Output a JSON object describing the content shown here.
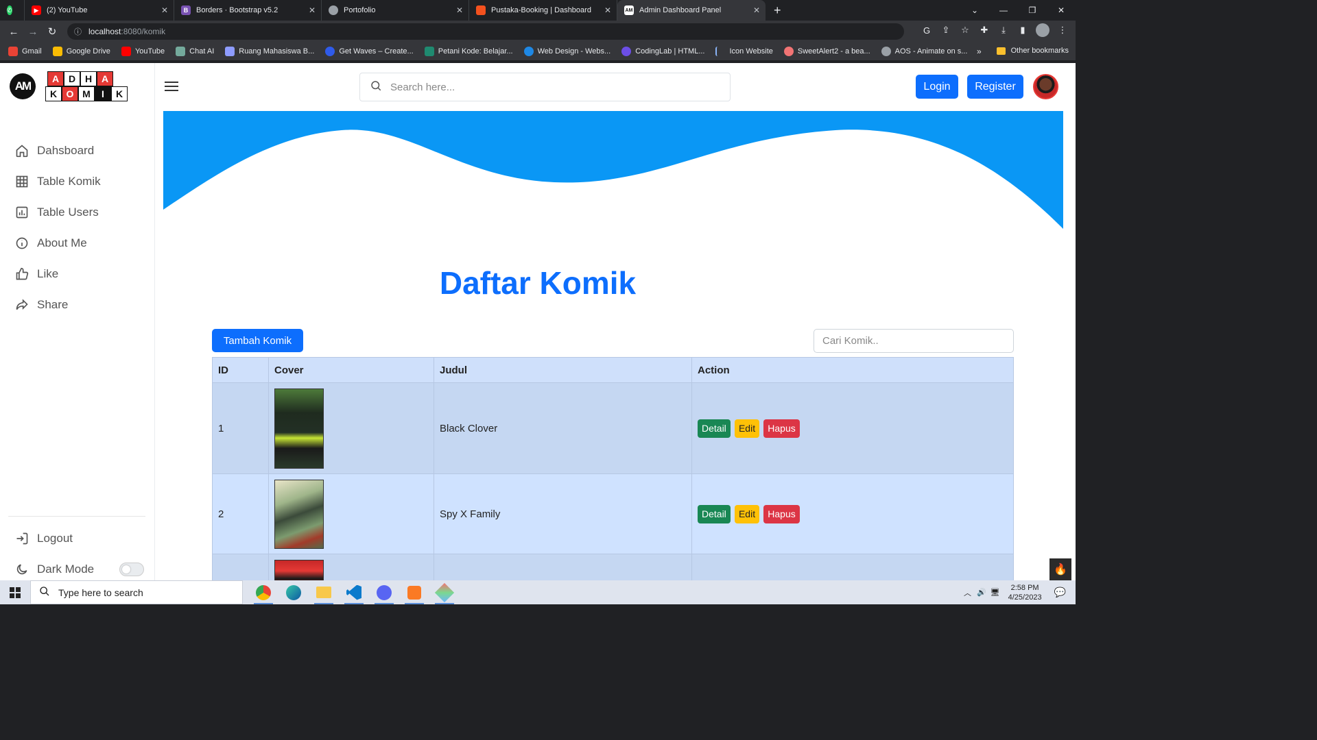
{
  "browser": {
    "tabs": [
      {
        "title": "(2) YouTube",
        "color": "#ff0000"
      },
      {
        "title": "Borders · Bootstrap v5.2",
        "color": "#7952b3",
        "glyph": "B"
      },
      {
        "title": "Portofolio",
        "color": "#9aa0a6"
      },
      {
        "title": "Pustaka-Booking | Dashboard",
        "color": "#f4511e"
      },
      {
        "title": "Admin Dashboard Panel",
        "color": "#ffffff",
        "glyph": "AM",
        "active": true
      }
    ],
    "url_host": "localhost",
    "url_path": ":8080/komik",
    "bookmarks": [
      "Gmail",
      "Google Drive",
      "YouTube",
      "Chat AI",
      "Ruang Mahasiswa B...",
      "Get Waves – Create...",
      "Petani Kode: Belajar...",
      "Web Design - Webs...",
      "CodingLab | HTML...",
      "Icon Website",
      "SweetAlert2 - a bea...",
      "AOS - Animate on s..."
    ],
    "bookmark_more": "»",
    "other_bookmarks": "Other bookmarks"
  },
  "sidebar": {
    "logo_mark": "AM",
    "logo_row1": [
      "A",
      "D",
      "H",
      "A"
    ],
    "logo_row2": [
      "K",
      "O",
      "M",
      "I",
      "K"
    ],
    "items": [
      {
        "label": "Dahsboard",
        "icon": "home-icon"
      },
      {
        "label": "Table Komik",
        "icon": "grid-icon"
      },
      {
        "label": "Table Users",
        "icon": "bar-chart-icon"
      },
      {
        "label": "About Me",
        "icon": "info-icon"
      },
      {
        "label": "Like",
        "icon": "thumbs-up-icon"
      },
      {
        "label": "Share",
        "icon": "share-icon"
      }
    ],
    "logout": "Logout",
    "dark_mode": "Dark Mode",
    "dark_mode_on": false
  },
  "header": {
    "search_placeholder": "Search here...",
    "login": "Login",
    "register": "Register"
  },
  "main": {
    "title": "Daftar Komik",
    "add_button": "Tambah Komik",
    "search_placeholder": "Cari Komik..",
    "columns": [
      "ID",
      "Cover",
      "Judul",
      "Action"
    ],
    "rows": [
      {
        "id": "1",
        "judul": "Black Clover"
      },
      {
        "id": "2",
        "judul": "Spy X Family"
      },
      {
        "id": "",
        "judul": ""
      }
    ],
    "actions": {
      "detail": "Detail",
      "edit": "Edit",
      "hapus": "Hapus"
    }
  },
  "taskbar": {
    "search_placeholder": "Type here to search",
    "time": "2:58 PM",
    "date": "4/25/2023"
  },
  "colors": {
    "primary": "#0d6efd",
    "wave": "#0a97f5",
    "success": "#198754",
    "warning": "#ffc107",
    "danger": "#dc3545"
  }
}
